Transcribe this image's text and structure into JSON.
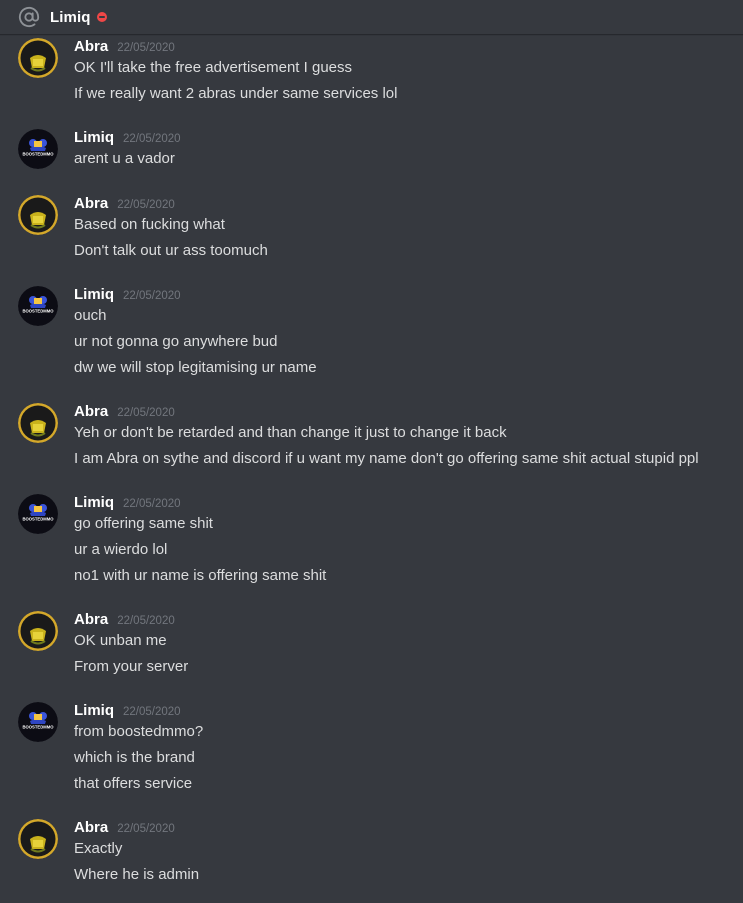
{
  "header": {
    "channel_name": "Limiq",
    "at_icon": "at-sign-icon",
    "status_icon": "do-not-disturb-icon"
  },
  "avatars": {
    "Abra": {
      "text": "Abra",
      "ring": "#d4a82a",
      "bg": "#1a1a1a"
    },
    "Limiq": {
      "text": "BOOSTEDMMO",
      "bg": "#0c0c14"
    }
  },
  "messages": [
    {
      "author": "Abra",
      "timestamp": "22/05/2020",
      "lines": [
        "OK I'll take the free advertisement I guess",
        "If we really want 2 abras under same services lol"
      ]
    },
    {
      "author": "Limiq",
      "timestamp": "22/05/2020",
      "lines": [
        "arent u a vador"
      ]
    },
    {
      "author": "Abra",
      "timestamp": "22/05/2020",
      "lines": [
        "Based on fucking what",
        "Don't talk out ur ass toomuch"
      ]
    },
    {
      "author": "Limiq",
      "timestamp": "22/05/2020",
      "lines": [
        "ouch",
        "ur not gonna go anywhere bud",
        "dw we will stop legitamising ur name"
      ]
    },
    {
      "author": "Abra",
      "timestamp": "22/05/2020",
      "lines": [
        "Yeh or don't be retarded and than change it just to change it back",
        "I am Abra on sythe and discord if u want my name don't go offering same shit actual stupid ppl"
      ]
    },
    {
      "author": "Limiq",
      "timestamp": "22/05/2020",
      "lines": [
        "go offering same shit",
        "ur a wierdo lol",
        "no1 with ur name is offering same shit"
      ]
    },
    {
      "author": "Abra",
      "timestamp": "22/05/2020",
      "lines": [
        "OK unban me",
        "From your server"
      ]
    },
    {
      "author": "Limiq",
      "timestamp": "22/05/2020",
      "lines": [
        "from boostedmmo?",
        "which is the brand",
        "that offers service"
      ]
    },
    {
      "author": "Abra",
      "timestamp": "22/05/2020",
      "lines": [
        "Exactly",
        "Where he is admin"
      ]
    }
  ]
}
